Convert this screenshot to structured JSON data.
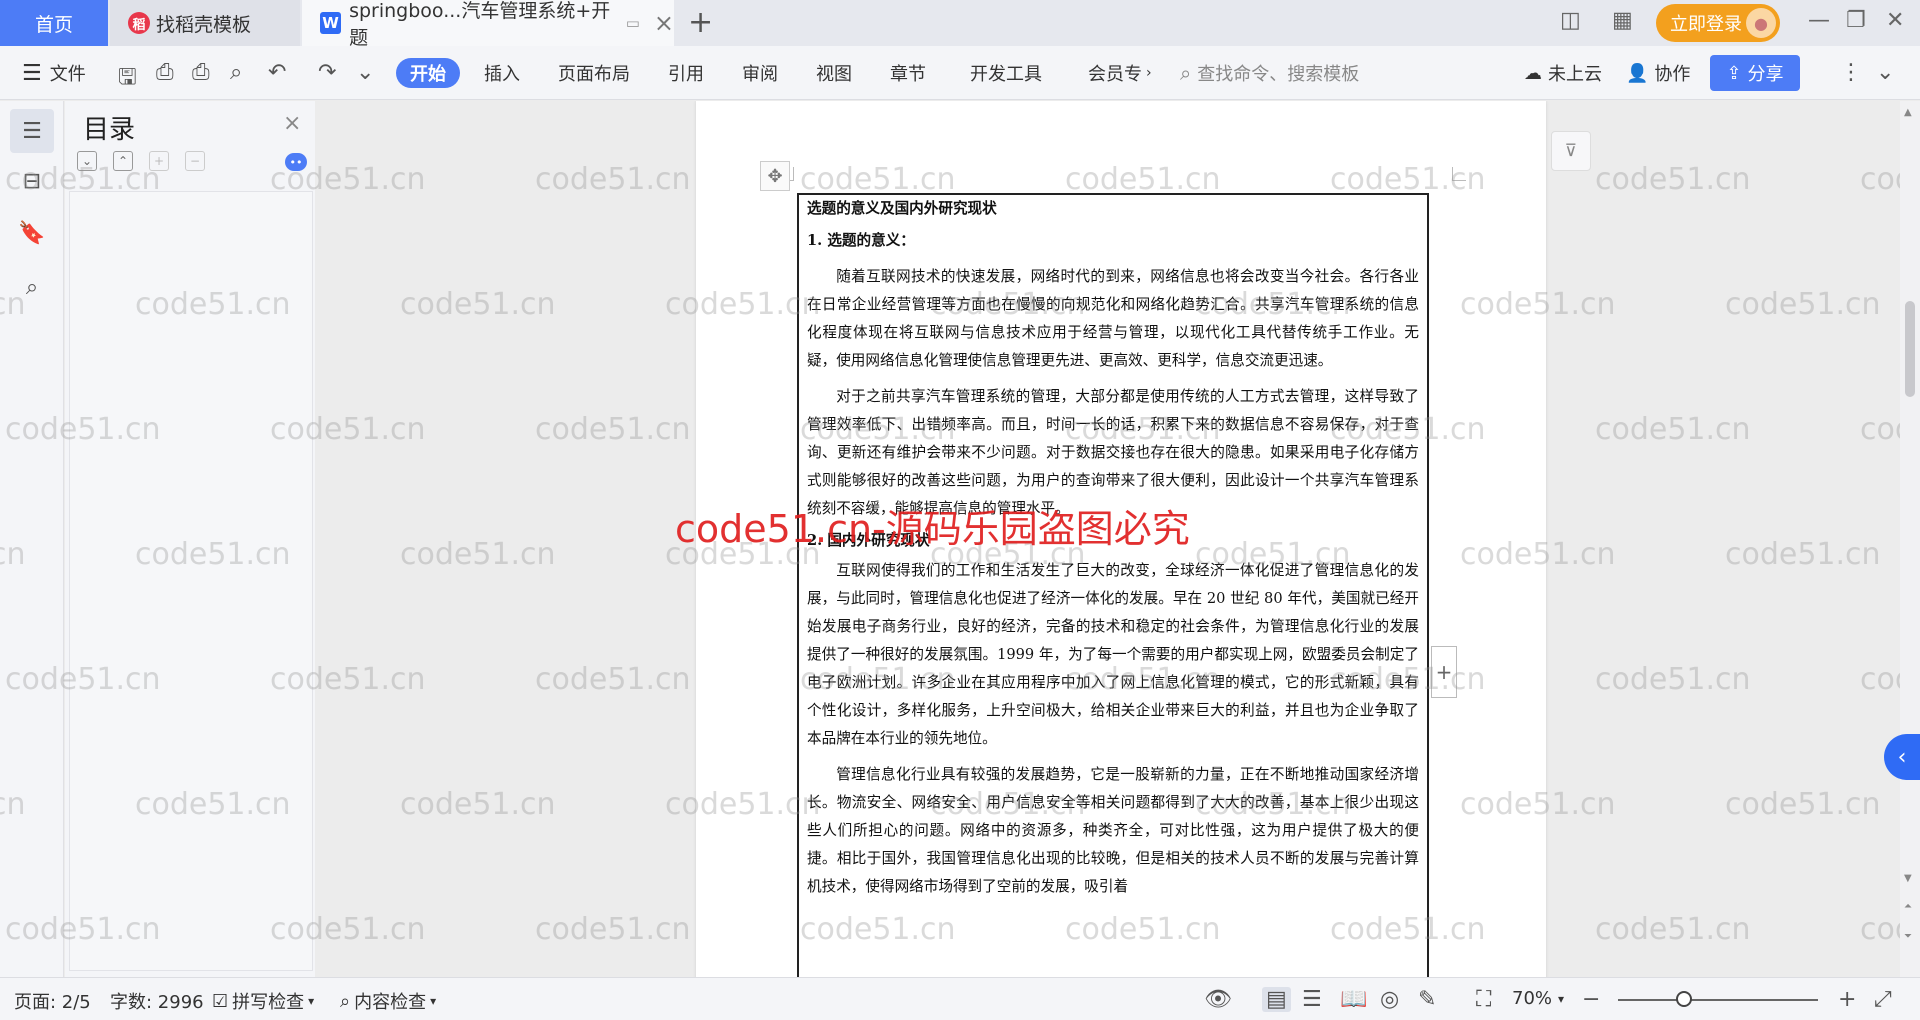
{
  "tabs": {
    "home": "首页",
    "template": "找稻壳模板",
    "document": "springboo...汽车管理系统+开题",
    "document_icon": "W",
    "new_tab": "+"
  },
  "window": {
    "login": "立即登录"
  },
  "menu": {
    "file": "文件",
    "start": "开始",
    "insert": "插入",
    "layout": "页面布局",
    "reference": "引用",
    "review": "审阅",
    "view": "视图",
    "chapter": "章节",
    "devtools": "开发工具",
    "member": "会员专",
    "search_placeholder": "查找命令、搜索模板",
    "cloud": "未上云",
    "collab": "协作",
    "share": "分享"
  },
  "toc": {
    "title": "目录"
  },
  "document": {
    "heading_main": "选题的意义及国内外研究现状",
    "heading_1": "1. 选题的意义：",
    "para_1": "随着互联网技术的快速发展，网络时代的到来，网络信息也将会改变当今社会。各行各业在日常企业经营管理等方面也在慢慢的向规范化和网络化趋势汇合。共享汽车管理系统的信息化程度体现在将互联网与信息技术应用于经营与管理，以现代化工具代替传统手工作业。无疑，使用网络信息化管理使信息管理更先进、更高效、更科学，信息交流更迅速。",
    "para_2": "对于之前共享汽车管理系统的管理，大部分都是使用传统的人工方式去管理，这样导致了管理效率低下、出错频率高。而且，时间一长的话，积累下来的数据信息不容易保存，对于查询、更新还有维护会带来不少问题。对于数据交接也存在很大的隐患。如果采用电子化存储方式则能够很好的改善这些问题，为用户的查询带来了很大便利，因此设计一个共享汽车管理系统刻不容缓，能够提高信息的管理水平。",
    "heading_2": "2. 国内外研究现状",
    "para_3": "互联网使得我们的工作和生活发生了巨大的改变，全球经济一体化促进了管理信息化的发展，与此同时，管理信息化也促进了经济一体化的发展。早在 20 世纪 80 年代，美国就已经开始发展电子商务行业，良好的经济，完备的技术和稳定的社会条件，为管理信息化行业的发展提供了一种很好的发展氛围。1999 年，为了每一个需要的用户都实现上网，欧盟委员会制定了电子欧洲计划。许多企业在其应用程序中加入了网上信息化管理的模式，它的形式新颖，具有个性化设计，多样化服务，上升空间极大，给相关企业带来巨大的利益，并且也为企业争取了本品牌在本行业的领先地位。",
    "para_4": "管理信息化行业具有较强的发展趋势，它是一股崭新的力量，正在不断地推动国家经济增长。物流安全、网络安全、用户信息安全等相关问题都得到了大大的改善，基本上很少出现这些人们所担心的问题。网络中的资源多，种类齐全，可对比性强，这为用户提供了极大的便捷。相比于国外，我国管理信息化出现的比较晚，但是相关的技术人员不断的发展与完善计算机技术，使得网络市场得到了空前的发展，吸引着"
  },
  "watermark": {
    "text": "code51.cn",
    "red_text": "code51.cn-源码乐园盗图必究"
  },
  "status": {
    "page": "页面: 2/5",
    "words": "字数: 2996",
    "spell": "拼写检查",
    "content_check": "内容检查",
    "zoom": "70%"
  },
  "colors": {
    "accent": "#4d7cf6",
    "login": "#f3a01e",
    "watermark_red": "#e01e1e"
  },
  "icons": [
    "menu-icon",
    "save-icon",
    "print-icon",
    "undo-icon",
    "redo-icon",
    "search-icon",
    "cloud-icon",
    "collab-icon",
    "share-icon",
    "toc-icon",
    "bookmark-icon",
    "eye-icon",
    "zoom-in-icon",
    "zoom-out-icon",
    "fullscreen-icon"
  ]
}
